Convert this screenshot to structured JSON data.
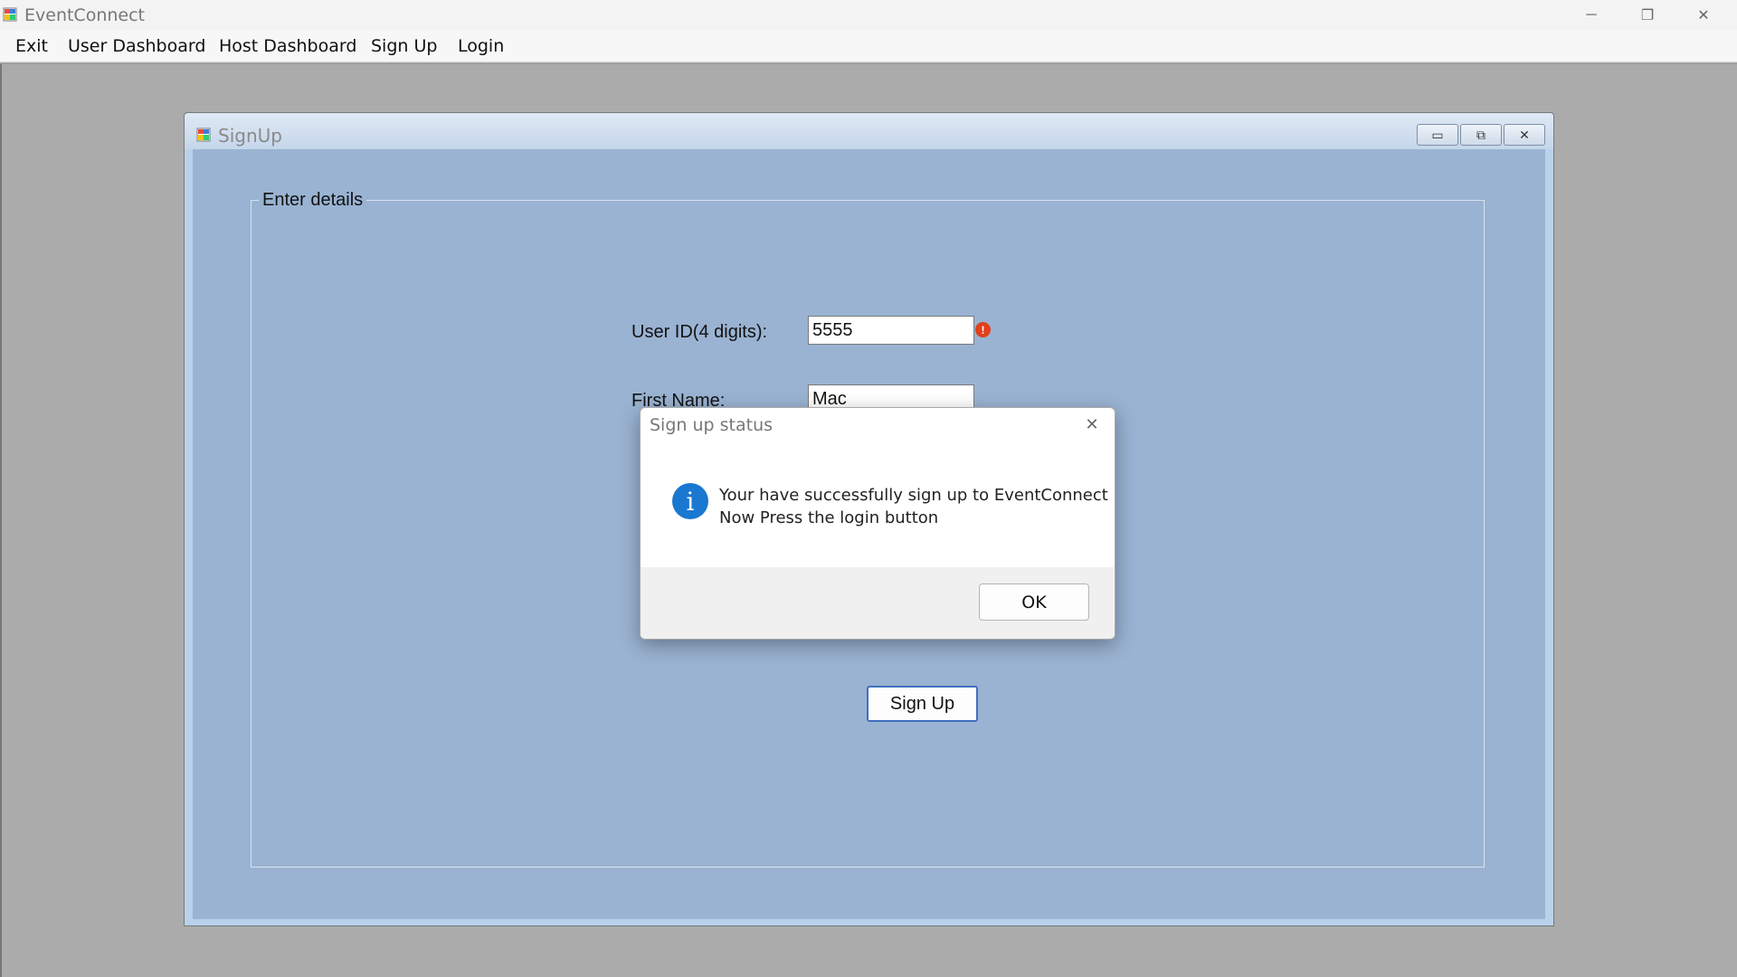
{
  "app": {
    "title": "EventConnect",
    "icon": "app-window-icon",
    "window_controls": {
      "minimize": "─",
      "restore": "❐",
      "close": "✕"
    }
  },
  "menu": {
    "items": [
      "Exit",
      "User Dashboard",
      "Host Dashboard",
      "Sign Up",
      "Login"
    ]
  },
  "child_window": {
    "title": "SignUp",
    "controls": {
      "minimize": "▭",
      "restore": "⧉",
      "close": "✕"
    }
  },
  "form": {
    "group_title": "Enter details",
    "user_id_label": "User ID(4 digits):",
    "user_id_value": "5555",
    "user_id_error_icon": "!",
    "first_name_label": "First Name:",
    "first_name_value": "Mac",
    "signup_button": "Sign Up"
  },
  "dialog": {
    "title": "Sign up status",
    "close": "✕",
    "icon_glyph": "i",
    "message_line1": "Your have successfully sign up to EventConnect",
    "message_line2": "Now Press the login button",
    "ok_button": "OK"
  },
  "colors": {
    "child_client": "#9ab3d2",
    "error": "#e2401c",
    "info": "#1a78d0",
    "button_focus": "#3f6fbf"
  }
}
